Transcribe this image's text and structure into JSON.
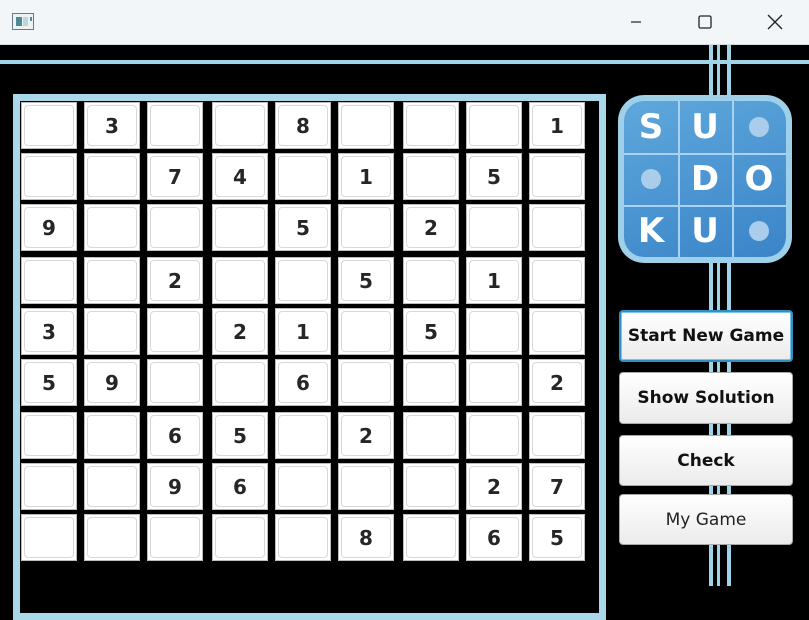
{
  "window": {
    "icon": "app-window-icon",
    "controls": [
      "minimize-icon",
      "maximize-icon",
      "close-icon"
    ]
  },
  "colors": {
    "accent": "#9fd4e8",
    "background": "#000000",
    "logo_blue": "#3b84c8",
    "focus_border": "#2f8fc4"
  },
  "grid": [
    [
      "",
      "3",
      "",
      "",
      "8",
      "",
      "",
      "",
      "1"
    ],
    [
      "",
      "",
      "7",
      "4",
      "",
      "1",
      "",
      "5",
      ""
    ],
    [
      "9",
      "",
      "",
      "",
      "5",
      "",
      "2",
      "",
      ""
    ],
    [
      "",
      "",
      "2",
      "",
      "",
      "5",
      "",
      "1",
      ""
    ],
    [
      "3",
      "",
      "",
      "2",
      "1",
      "",
      "5",
      "",
      ""
    ],
    [
      "5",
      "9",
      "",
      "",
      "6",
      "",
      "",
      "",
      "2"
    ],
    [
      "",
      "",
      "6",
      "5",
      "",
      "2",
      "",
      "",
      ""
    ],
    [
      "",
      "",
      "9",
      "6",
      "",
      "",
      "",
      "2",
      "7"
    ],
    [
      "",
      "",
      "",
      "",
      "",
      "8",
      "",
      "6",
      "5"
    ]
  ],
  "logo": {
    "cells": [
      [
        "S",
        "U",
        "*"
      ],
      [
        "*",
        "D",
        "O"
      ],
      [
        "K",
        "U",
        "*"
      ]
    ]
  },
  "buttons": {
    "start_new_game": "Start New Game",
    "show_solution": "Show Solution",
    "check": "Check",
    "my_game": "My Game"
  }
}
